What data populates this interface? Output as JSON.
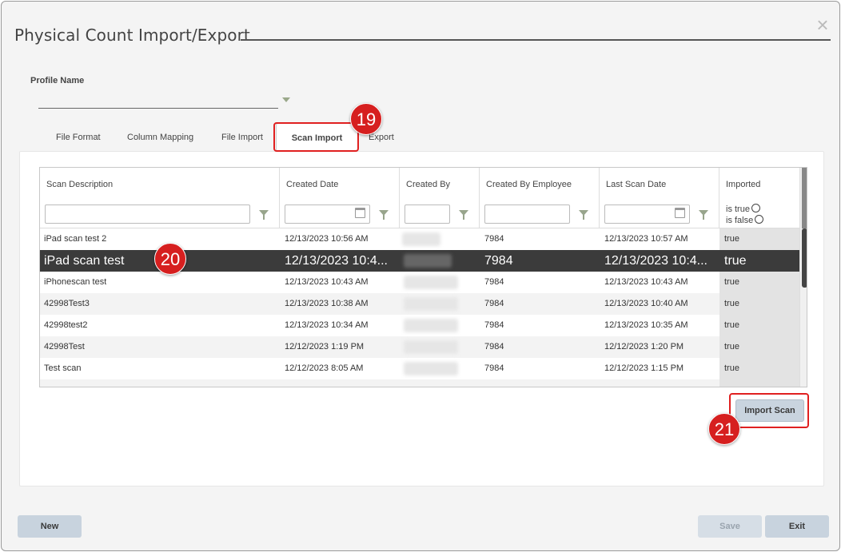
{
  "dialog": {
    "title": "Physical Count Import/Export",
    "close_glyph": "×"
  },
  "profile": {
    "label": "Profile Name",
    "value": ""
  },
  "tabs": [
    {
      "label": "File Format"
    },
    {
      "label": "Column Mapping"
    },
    {
      "label": "File Import"
    },
    {
      "label": "Scan Import",
      "active": true
    },
    {
      "label": "Export"
    }
  ],
  "badges": {
    "tab": "19",
    "row": "20",
    "import": "21"
  },
  "grid": {
    "columns": [
      {
        "title": "Scan Description"
      },
      {
        "title": "Created Date"
      },
      {
        "title": "Created By"
      },
      {
        "title": "Created By Employee"
      },
      {
        "title": "Last Scan Date"
      },
      {
        "title": "Imported"
      }
    ],
    "imported_filter": {
      "is_true": "is true",
      "is_false": "is false"
    },
    "rows": [
      {
        "description": "iPad scan test 2",
        "created_date": "12/13/2023 10:56 AM",
        "employee": "7984",
        "last_scan": "12/13/2023 10:57 AM",
        "imported": "true"
      },
      {
        "description": "iPad scan test",
        "created_date": "12/13/2023 10:4...",
        "employee": "7984",
        "last_scan": "12/13/2023 10:4...",
        "imported": "true",
        "selected": true
      },
      {
        "description": "iPhonescan test",
        "created_date": "12/13/2023 10:43 AM",
        "employee": "7984",
        "last_scan": "12/13/2023 10:43 AM",
        "imported": "true"
      },
      {
        "description": "42998Test3",
        "created_date": "12/13/2023 10:38 AM",
        "employee": "7984",
        "last_scan": "12/13/2023 10:40 AM",
        "imported": "true"
      },
      {
        "description": "42998test2",
        "created_date": "12/13/2023 10:34 AM",
        "employee": "7984",
        "last_scan": "12/13/2023 10:35 AM",
        "imported": "true"
      },
      {
        "description": "42998Test",
        "created_date": "12/12/2023 1:19 PM",
        "employee": "7984",
        "last_scan": "12/12/2023 1:20 PM",
        "imported": "true"
      },
      {
        "description": "Test scan",
        "created_date": "12/12/2023 8:05 AM",
        "employee": "7984",
        "last_scan": "12/12/2023 1:15 PM",
        "imported": "true"
      }
    ]
  },
  "buttons": {
    "import_scan": "Import Scan",
    "new": "New",
    "save": "Save",
    "exit": "Exit"
  },
  "colors": {
    "highlight": "#e02020",
    "badge": "#d61f1f",
    "selected_row": "#3b3b3b",
    "button": "#c8d3de"
  }
}
